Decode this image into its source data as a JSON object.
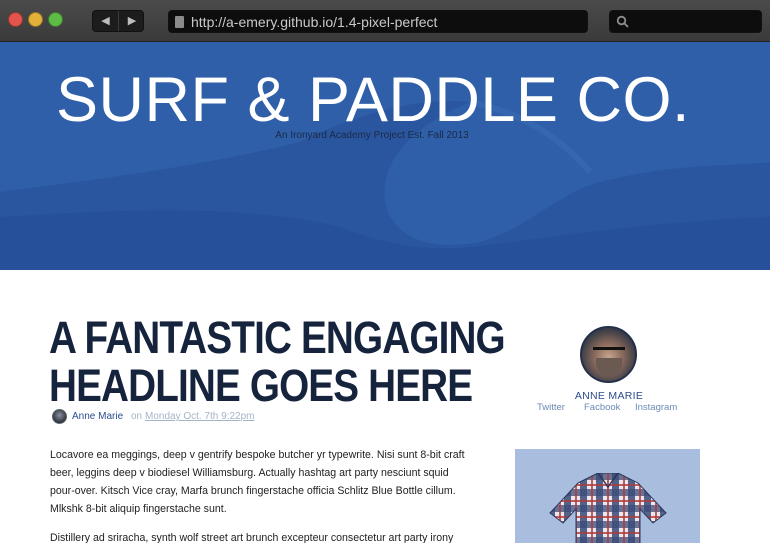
{
  "browser": {
    "url": "http://a-emery.github.io/1.4-pixel-perfect",
    "back_icon": "◀",
    "forward_icon": "▶"
  },
  "hero": {
    "title": "SURF & PADDLE CO.",
    "tagline": "An Ironyard Academy Project Est. Fall 2013"
  },
  "post": {
    "headline_line1": "A FANTASTIC ENGAGING",
    "headline_line2": "HEADLINE GOES HERE",
    "author": "Anne Marie",
    "on": "on",
    "date": "Monday Oct. 7th 9:22pm",
    "paragraph1": "Locavore ea meggings, deep v gentrify bespoke butcher yr typewrite. Nisi sunt 8-bit craft beer, leggins deep v biodiesel Williamsburg. Actually hashtag art party nesciunt squid pour-over. Kitsch Vice cray, Marfa brunch fingerstache officia Schlitz Blue Bottle cillum. Mlkshk 8-bit aliquip fingerstache sunt.",
    "paragraph2": "Distillery ad sriracha, synth wolf street art brunch excepteur consectetur art party irony"
  },
  "sidebar": {
    "author_name": "ANNE MARIE",
    "social": [
      "Twitter",
      "Facbook",
      "Instagram"
    ]
  },
  "colors": {
    "hero_blue": "#2f5fa9",
    "headline_navy": "#16233d",
    "link_blue": "#2c4b8c"
  }
}
